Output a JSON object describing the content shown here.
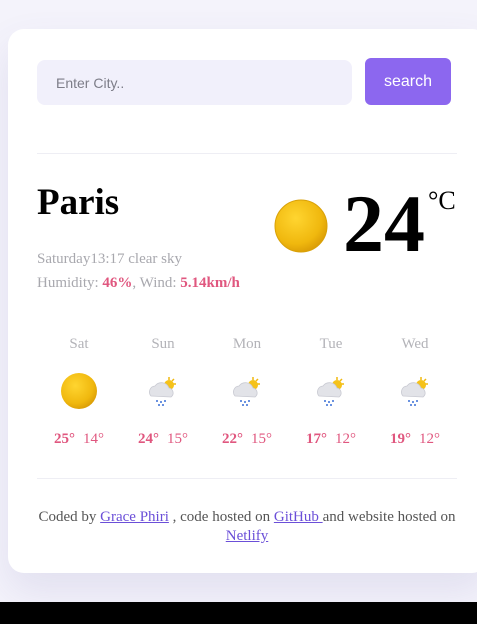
{
  "search": {
    "placeholder": "Enter City..",
    "value": "",
    "button_label": "search"
  },
  "current": {
    "city": "Paris",
    "day": "Saturday",
    "time": "13:17",
    "description": "clear sky",
    "humidity_label": "Humidity:",
    "humidity": "46%",
    "wind_label": ", Wind:",
    "wind": "5.14km/h",
    "temperature": "24",
    "unit": "°C",
    "icon": "sun-icon"
  },
  "forecast": [
    {
      "day": "Sat",
      "icon": "sun-icon",
      "max": "25°",
      "min": "14°"
    },
    {
      "day": "Sun",
      "icon": "rain-cloud-sun-icon",
      "max": "24°",
      "min": "15°"
    },
    {
      "day": "Mon",
      "icon": "rain-cloud-sun-icon",
      "max": "22°",
      "min": "15°"
    },
    {
      "day": "Tue",
      "icon": "rain-cloud-sun-icon",
      "max": "17°",
      "min": "12°"
    },
    {
      "day": "Wed",
      "icon": "rain-cloud-sun-icon",
      "max": "19°",
      "min": "12°"
    }
  ],
  "footer": {
    "prefix": "Coded by ",
    "author": "Grace Phiri",
    "middle": " , code hosted on ",
    "github": "GitHub ",
    "middle2": "and website hosted on ",
    "netlify": "Netlify"
  },
  "colors": {
    "accent": "#8c67ef",
    "highlight": "#e0577f",
    "sun": "#f0b80e"
  }
}
